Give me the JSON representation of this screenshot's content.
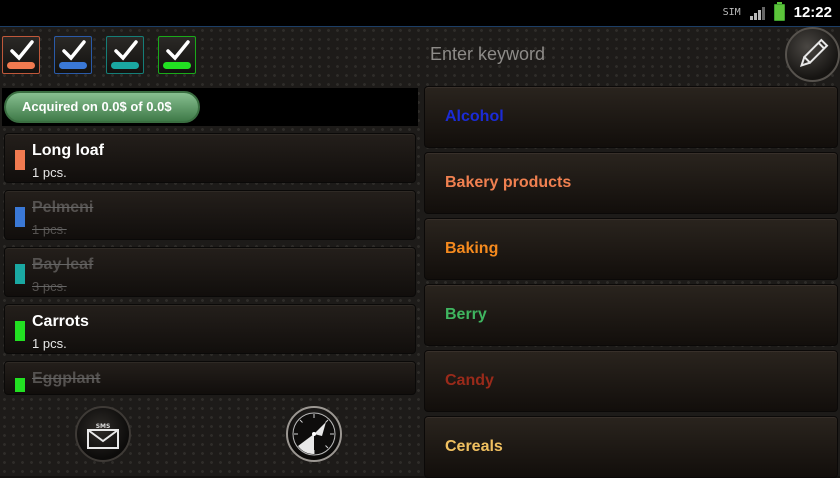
{
  "status_bar": {
    "clock": "12:22",
    "sim_label": "SIM",
    "icons": [
      "sim-card-icon",
      "signal-icon",
      "battery-icon"
    ]
  },
  "color_filters": [
    {
      "name": "orange",
      "color": "#f07a50",
      "border": "#c0583a"
    },
    {
      "name": "blue",
      "color": "#3a78d6",
      "border": "#2a5aa8"
    },
    {
      "name": "teal",
      "color": "#1aa8a2",
      "border": "#157e78"
    },
    {
      "name": "green",
      "color": "#22e022",
      "border": "#1aaa1a"
    }
  ],
  "search": {
    "placeholder": "Enter keyword"
  },
  "summary": {
    "text": "Acquired on 0.0$ of 0.0$",
    "progress": 0
  },
  "shopping_list": [
    {
      "name": "Long loaf",
      "qty": "1 pcs.",
      "color": "#f07a50",
      "done": false
    },
    {
      "name": "Pelmeni",
      "qty": "1 pcs.",
      "color": "#3a78d6",
      "done": true
    },
    {
      "name": "Bay leaf",
      "qty": "3 pcs.",
      "color": "#1aa8a2",
      "done": true
    },
    {
      "name": "Carrots",
      "qty": "1 pcs.",
      "color": "#22e022",
      "done": false
    },
    {
      "name": "Eggplant",
      "qty": "",
      "color": "#22e022",
      "done": true
    }
  ],
  "bottom_buttons": {
    "sms_label": "SMS",
    "icons": [
      "sms-envelope-icon",
      "clock-dial-icon"
    ]
  },
  "categories": [
    {
      "label": "Alcohol",
      "color": "#1b2bd6"
    },
    {
      "label": "Bakery products",
      "color": "#f08050"
    },
    {
      "label": "Baking",
      "color": "#f58a1e"
    },
    {
      "label": "Berry",
      "color": "#3fb560"
    },
    {
      "label": "Candy",
      "color": "#9a2a1a"
    },
    {
      "label": "Cereals",
      "color": "#f0c060"
    }
  ]
}
